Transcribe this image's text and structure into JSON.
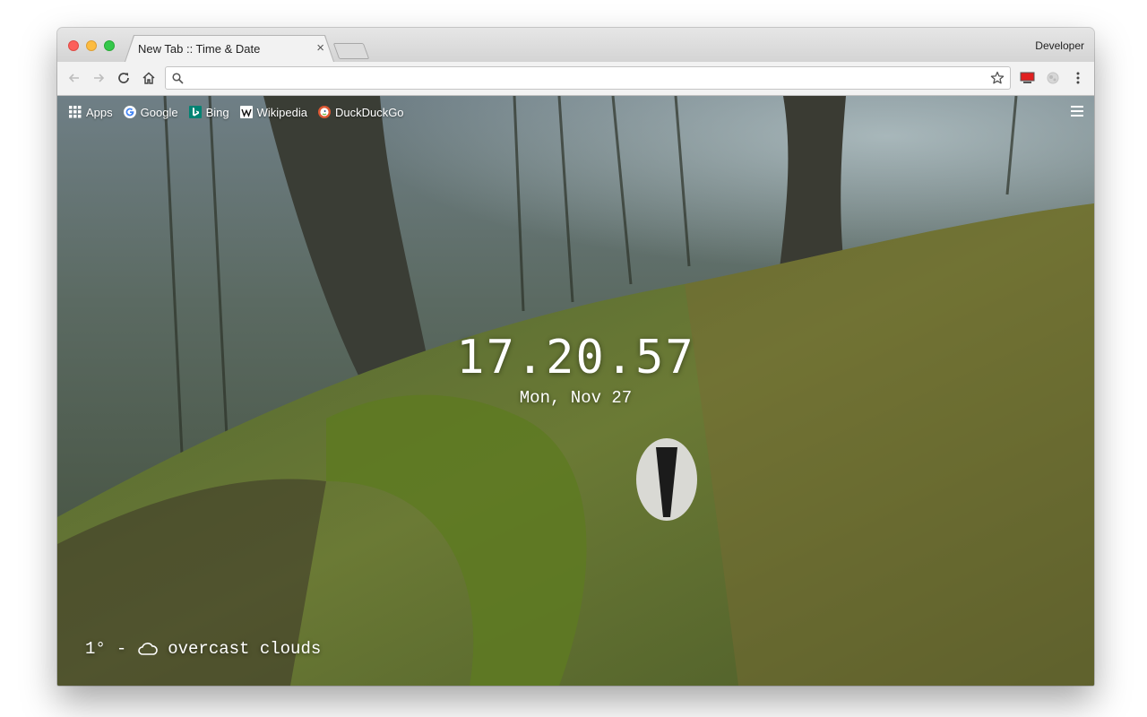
{
  "window": {
    "profile_name": "Developer"
  },
  "tab": {
    "title": "New Tab :: Time & Date",
    "close_glyph": "×"
  },
  "toolbar": {
    "omnibox_value": "",
    "icons": [
      "back-arrow-icon",
      "forward-arrow-icon",
      "reload-icon",
      "home-icon",
      "search-icon",
      "star-icon",
      "extension-flag-icon",
      "extension-globe-icon",
      "kebab-menu-icon"
    ]
  },
  "bookmarks": [
    {
      "label": "Apps",
      "icon": "apps-grid-icon"
    },
    {
      "label": "Google",
      "icon": "google-icon"
    },
    {
      "label": "Bing",
      "icon": "bing-icon"
    },
    {
      "label": "Wikipedia",
      "icon": "wikipedia-icon"
    },
    {
      "label": "DuckDuckGo",
      "icon": "duckduckgo-icon"
    }
  ],
  "clock": {
    "time": "17.20.57",
    "date": "Mon, Nov 27"
  },
  "weather": {
    "temperature": "1°",
    "separator": "-",
    "condition": "overcast clouds",
    "icon": "cloud-icon"
  },
  "colors": {
    "close_light": "#fc605b",
    "minimize_light": "#fdbc40",
    "maximize_light": "#34c84a"
  }
}
